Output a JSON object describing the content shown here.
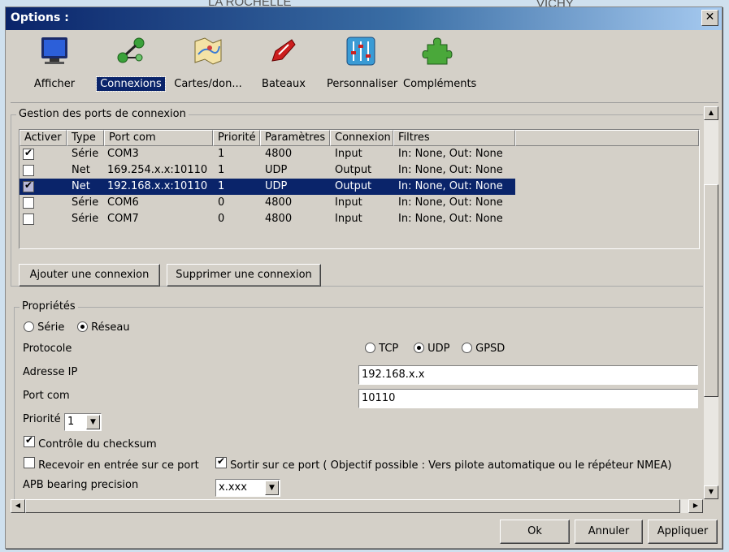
{
  "background": {
    "labels": [
      "LA ROCHELLE",
      "VICHY"
    ]
  },
  "window": {
    "title": "Options :",
    "close_label": "✕"
  },
  "toolbar": {
    "items": [
      {
        "label": "Afficher",
        "icon": "monitor-icon"
      },
      {
        "label": "Connexions",
        "icon": "connections-icon",
        "selected": true
      },
      {
        "label": "Cartes/don...",
        "icon": "charts-icon"
      },
      {
        "label": "Bateaux",
        "icon": "boat-icon"
      },
      {
        "label": "Personnaliser",
        "icon": "sliders-icon"
      },
      {
        "label": "Compléments",
        "icon": "puzzle-icon"
      }
    ]
  },
  "ports": {
    "group_label": "Gestion des ports de connexion",
    "columns": [
      "Activer",
      "Type",
      "Port com",
      "Priorité",
      "Paramètres",
      "Connexion",
      "Filtres"
    ],
    "rows": [
      {
        "active": true,
        "type": "Série",
        "port": "COM3",
        "priority": "1",
        "params": "4800",
        "connection": "Input",
        "filters": "In: None, Out: None",
        "selected": false
      },
      {
        "active": false,
        "type": "Net",
        "port": "169.254.x.x:10110",
        "priority": "1",
        "params": "UDP",
        "connection": "Output",
        "filters": "In: None, Out: None",
        "selected": false
      },
      {
        "active": true,
        "type": "Net",
        "port": "192.168.x.x:10110",
        "priority": "1",
        "params": "UDP",
        "connection": "Output",
        "filters": "In: None, Out: None",
        "selected": true
      },
      {
        "active": false,
        "type": "Série",
        "port": "COM6",
        "priority": "0",
        "params": "4800",
        "connection": "Input",
        "filters": "In: None, Out: None",
        "selected": false
      },
      {
        "active": false,
        "type": "Série",
        "port": "COM7",
        "priority": "0",
        "params": "4800",
        "connection": "Input",
        "filters": "In: None, Out: None",
        "selected": false
      }
    ],
    "add_label": "Ajouter une connexion",
    "remove_label": "Supprimer une connexion"
  },
  "props": {
    "group_label": "Propriétés",
    "serial_label": "Série",
    "network_label": "Réseau",
    "network_selected": true,
    "protocol_label": "Protocole",
    "tcp_label": "TCP",
    "udp_label": "UDP",
    "gpsd_label": "GPSD",
    "protocol_selected": "UDP",
    "ip_label": "Adresse IP",
    "ip_value": "192.168.x.x",
    "port_label": "Port com",
    "port_value": "10110",
    "priority_label": "Priorité",
    "priority_value": "1",
    "checksum_label": "Contrôle du checksum",
    "checksum_checked": true,
    "receive_label": "Recevoir en entrée sur ce port",
    "receive_checked": false,
    "output_label": "Sortir sur ce port ( Objectif possible  :  Vers pilote automatique ou le répéteur NMEA)",
    "output_checked": true,
    "apb_label": "APB bearing precision",
    "apb_value": "x.xxx"
  },
  "buttons": {
    "ok": "Ok",
    "cancel": "Annuler",
    "apply": "Appliquer"
  }
}
